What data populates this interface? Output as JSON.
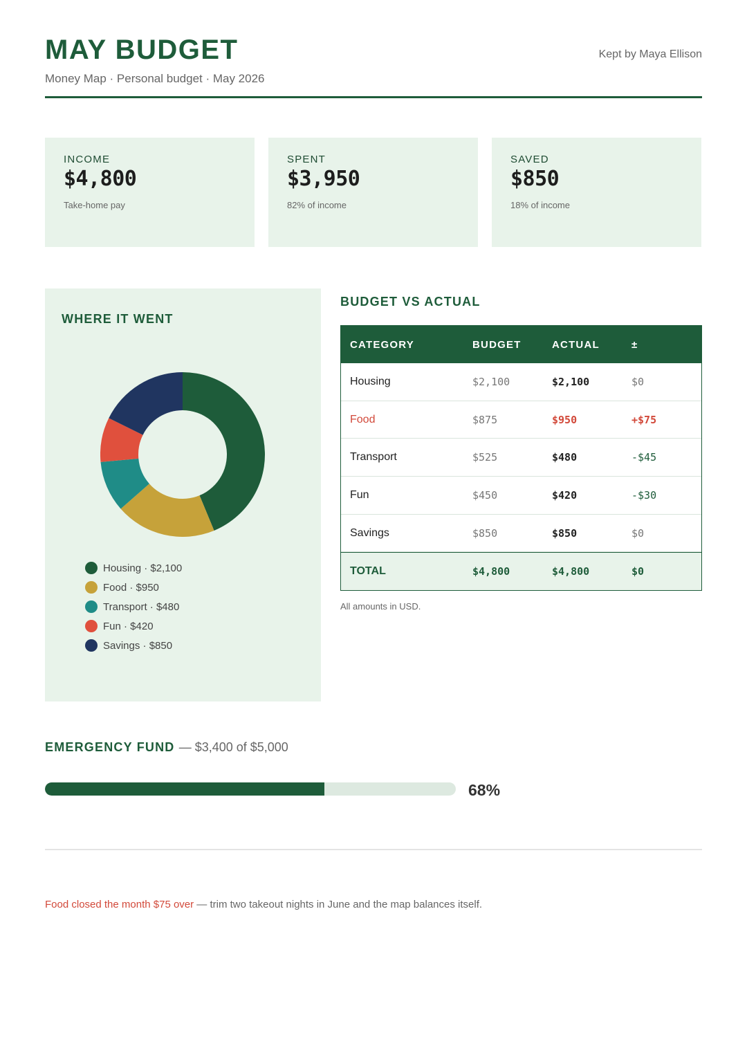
{
  "header": {
    "title": "MAY BUDGET",
    "subtitle": "Money Map · Personal budget · May 2026",
    "keeper": "Kept by Maya Ellison"
  },
  "cards": [
    {
      "label": "INCOME",
      "value": "$4,800",
      "note": "Take-home pay"
    },
    {
      "label": "SPENT",
      "value": "$3,950",
      "note": "82% of income"
    },
    {
      "label": "SAVED",
      "value": "$850",
      "note": "18% of income"
    }
  ],
  "donut_panel": {
    "title": "WHERE IT WENT",
    "legend": [
      {
        "label": "Housing · $2,100"
      },
      {
        "label": "Food · $950"
      },
      {
        "label": "Transport · $480"
      },
      {
        "label": "Fun · $420"
      },
      {
        "label": "Savings · $850"
      }
    ]
  },
  "chart_data": {
    "type": "pie",
    "categories": [
      "Housing",
      "Food",
      "Transport",
      "Fun",
      "Savings"
    ],
    "values": [
      2100,
      950,
      480,
      420,
      850
    ],
    "colors": [
      "#1e5c3a",
      "#c6a23a",
      "#1f8c87",
      "#e0503d",
      "#203560"
    ],
    "title": "WHERE IT WENT"
  },
  "bva": {
    "title": "BUDGET VS ACTUAL",
    "columns": [
      "CATEGORY",
      "BUDGET",
      "ACTUAL",
      "±"
    ],
    "rows": [
      {
        "category": "Housing",
        "budget": "$2,100",
        "actual": "$2,100",
        "diff": "$0",
        "status": "neutral"
      },
      {
        "category": "Food",
        "budget": "$875",
        "actual": "$950",
        "diff": "+$75",
        "status": "over"
      },
      {
        "category": "Transport",
        "budget": "$525",
        "actual": "$480",
        "diff": "-$45",
        "status": "under"
      },
      {
        "category": "Fun",
        "budget": "$450",
        "actual": "$420",
        "diff": "-$30",
        "status": "under"
      },
      {
        "category": "Savings",
        "budget": "$850",
        "actual": "$850",
        "diff": "$0",
        "status": "neutral"
      }
    ],
    "total": {
      "category": "TOTAL",
      "budget": "$4,800",
      "actual": "$4,800",
      "diff": "$0"
    },
    "note": "All amounts in USD."
  },
  "emergency_fund": {
    "title": "EMERGENCY FUND",
    "subtitle": "— $3,400 of $5,000",
    "progress": 0.68,
    "percent_label": "68%"
  },
  "footer": {
    "highlight": "Food closed the month $75 over",
    "rest": " — trim two takeout nights in June and the map balances itself."
  },
  "colors": {
    "primary": "#1e5c3a",
    "panel": "#e8f3ea",
    "over": "#d2493a"
  }
}
